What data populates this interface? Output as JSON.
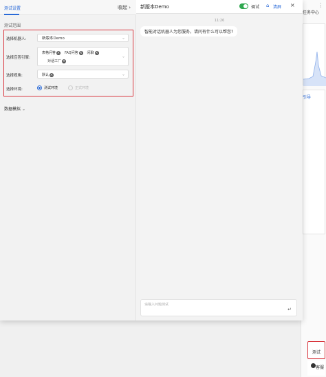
{
  "background": {
    "task_center": "任务中心",
    "link_text": "引导"
  },
  "left_panel": {
    "tab_label": "测试设置",
    "collapse_label": "收起",
    "section_title": "测试范围",
    "rows": {
      "robot": {
        "label": "选择机器人:",
        "value": "新版本Demo"
      },
      "engine": {
        "label": "选择应答引擎:",
        "chips": [
          "表格问答",
          "FAQ问答",
          "闲聊",
          "对话工厂"
        ]
      },
      "role": {
        "label": "选择视角:",
        "chips": [
          "默认"
        ]
      },
      "env": {
        "label": "选择环境:",
        "options": [
          {
            "label": "测试环境",
            "selected": true
          },
          {
            "label": "正式环境",
            "selected": false
          }
        ]
      }
    },
    "data_sim": "数据模拟"
  },
  "chat": {
    "title": "新版本Demo",
    "debug_label": "调试",
    "debug_on": true,
    "clear_label": "清屏",
    "time": "11:26",
    "message": "智能对话机器人为您服务，请问有什么可以帮您?",
    "input_placeholder": "请输入问题测试"
  },
  "floating": {
    "test_label": "测试",
    "service_label": "客服"
  },
  "colors": {
    "accent": "#2a6ad8",
    "highlight": "#d9363e",
    "toggle_on": "#2fa84f"
  }
}
